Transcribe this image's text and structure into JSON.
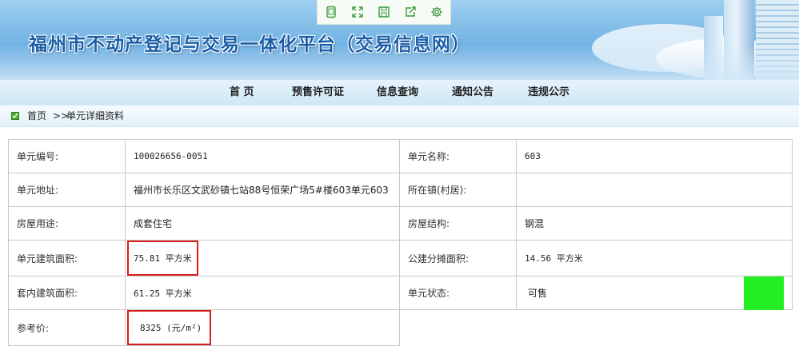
{
  "header": {
    "site_title": "福州市不动产登记与交易一体化平台（交易信息网）",
    "toolbar": [
      {
        "icon": "tablet-icon"
      },
      {
        "icon": "fullscreen-icon"
      },
      {
        "icon": "save-icon"
      },
      {
        "icon": "share-icon"
      },
      {
        "icon": "gear-icon"
      }
    ]
  },
  "nav": {
    "items": [
      "首  页",
      "预售许可证",
      "信息查询",
      "通知公告",
      "违规公示"
    ]
  },
  "breadcrumb": {
    "home": "首页",
    "separator": ">>",
    "current": "单元详细资料"
  },
  "unit": {
    "unit_no_label": "单元编号:",
    "unit_no": "100026656-0051",
    "unit_name_label": "单元名称:",
    "unit_name": "603",
    "address_label": "单元地址:",
    "address": "福州市长乐区文武砂镇七站88号恒荣广场5#楼603单元603",
    "town_label": "所在镇(村居):",
    "town": "",
    "usage_label": "房屋用途:",
    "usage": "成套住宅",
    "structure_label": "房屋结构:",
    "structure": "钢混",
    "building_area_label": "单元建筑面积:",
    "building_area": "75.81 平方米",
    "shared_area_label": "公建分摊面积:",
    "shared_area": "14.56 平方米",
    "inner_area_label": "套内建筑面积:",
    "inner_area": "61.25 平方米",
    "status_label": "单元状态:",
    "status": "可售",
    "status_color": "#22ee22",
    "price_label": "参考价:",
    "price": "8325 (元/m²)"
  },
  "colors": {
    "highlight_border": "#d81e1e",
    "title_blue": "#1a5ea8"
  }
}
